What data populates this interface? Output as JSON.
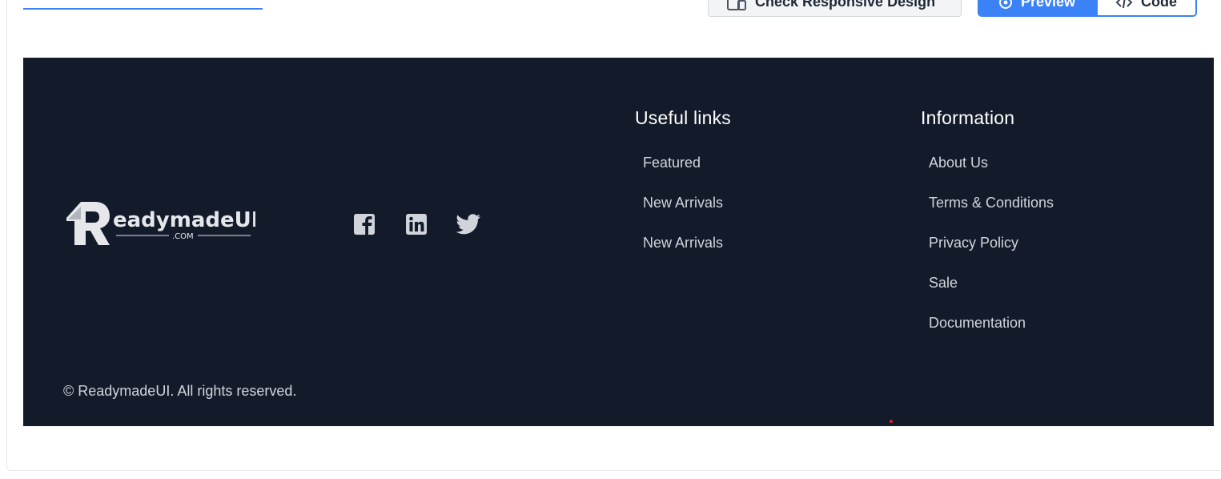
{
  "toolbar": {
    "responsive_label": "Check Responsive Design",
    "preview_label": "Preview",
    "code_label": "Code"
  },
  "brand": {
    "name": "ReadymadeUI",
    "logo_wordmark": "eadymadeUI",
    "logo_initial": "R",
    "logo_suffix": ".COM"
  },
  "socials": [
    {
      "icon": "facebook-icon"
    },
    {
      "icon": "linkedin-icon"
    },
    {
      "icon": "twitter-icon"
    }
  ],
  "useful_links": {
    "heading": "Useful links",
    "items": [
      "Featured",
      "New Arrivals",
      "New Arrivals"
    ]
  },
  "information": {
    "heading": "Information",
    "items": [
      "About Us",
      "Terms & Conditions",
      "Privacy Policy",
      "Sale",
      "Documentation"
    ]
  },
  "copyright": "© ReadymadeUI. All rights reserved.",
  "colors": {
    "footer_bg": "#131a2a",
    "accent": "#3b82f6",
    "text": "#d1d5db"
  }
}
